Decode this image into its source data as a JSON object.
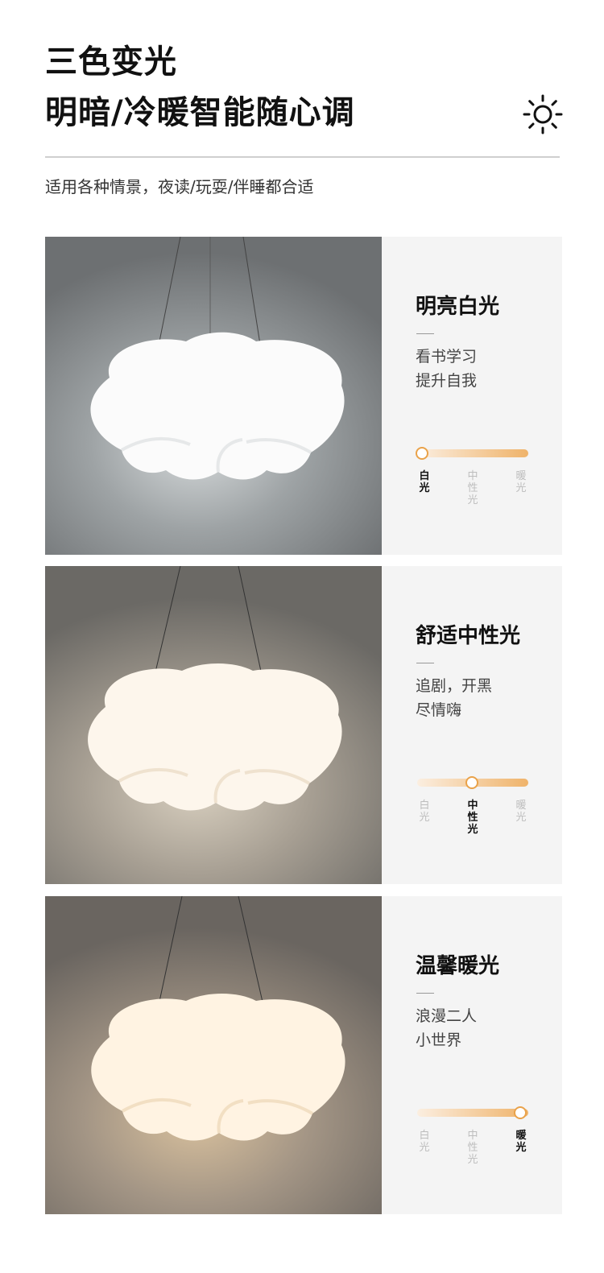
{
  "header": {
    "title_line1": "三色变光",
    "title_line2": "明暗/冷暖智能随心调",
    "subtitle": "适用各种情景，夜读/玩耍/伴睡都合适",
    "icon": "sun-icon"
  },
  "modes": [
    {
      "title": "明亮白光",
      "desc_line1": "看书学习",
      "desc_line2": "提升自我",
      "labels": [
        "白光",
        "中性光",
        "暖光"
      ],
      "active_label": 0
    },
    {
      "title": "舒适中性光",
      "desc_line1": "追剧，开黑",
      "desc_line2": "尽情嗨",
      "labels": [
        "白光",
        "中性光",
        "暖光"
      ],
      "active_label": 1
    },
    {
      "title": "温馨暖光",
      "desc_line1": "浪漫二人",
      "desc_line2": "小世界",
      "labels": [
        "白光",
        "中性光",
        "暖光"
      ],
      "active_label": 2
    }
  ],
  "colors": {
    "accent": "#e9a24a",
    "slider_start": "#fbeee0",
    "slider_end": "#efb36a"
  }
}
